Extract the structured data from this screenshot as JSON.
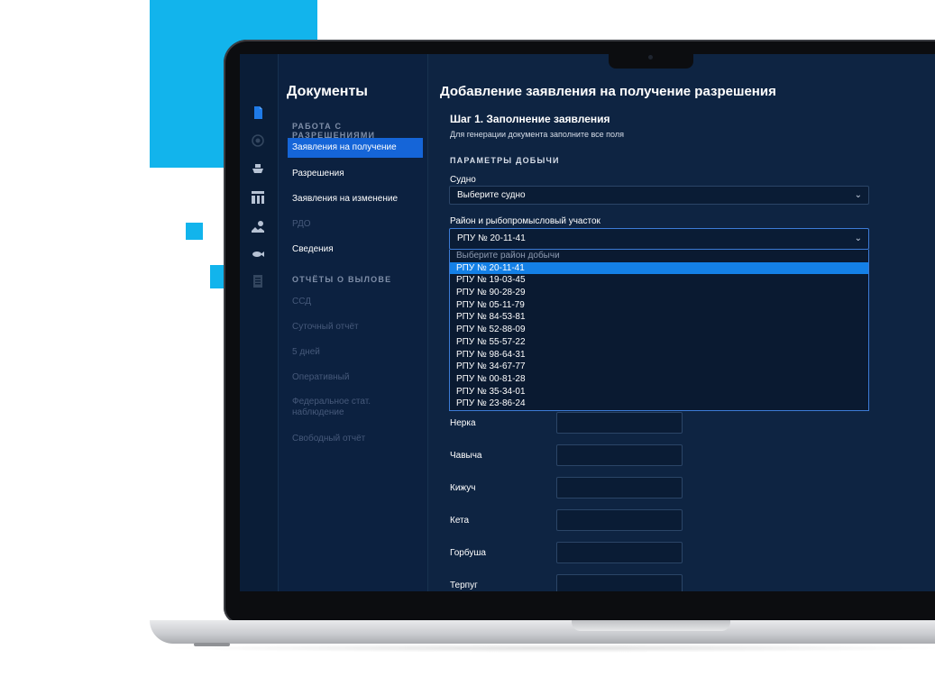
{
  "sidebar": {
    "title": "Документы",
    "section1": "РАБОТА С РАЗРЕШЕНИЯМИ",
    "items1": [
      {
        "label": "Заявления на получение"
      },
      {
        "label": "Разрешения"
      },
      {
        "label": "Заявления на изменение"
      },
      {
        "label": "РДО"
      },
      {
        "label": "Сведения"
      }
    ],
    "section2": "ОТЧЁТЫ О ВЫЛОВЕ",
    "items2": [
      {
        "label": "ССД"
      },
      {
        "label": "Суточный отчёт"
      },
      {
        "label": "5 дней"
      },
      {
        "label": "Оперативный"
      },
      {
        "label": "Федеральное стат. наблюдение"
      },
      {
        "label": "Свободный отчёт"
      }
    ]
  },
  "icons": [
    "documents-icon",
    "target-icon",
    "ship-icon",
    "dashboard-icon",
    "map-icon",
    "fish-icon",
    "report-icon"
  ],
  "main": {
    "title": "Добавление заявления на получение разрешения",
    "step_title": "Шаг 1. Заполнение заявления",
    "step_subtitle": "Для генерации документа заполните все поля",
    "params_heading": "ПАРАМЕТРЫ ДОБЫЧИ",
    "vessel": {
      "label": "Судно",
      "value": "Выберите судно"
    },
    "district": {
      "label": "Район и рыбопромысловый участок",
      "value": "РПУ № 20-11-41",
      "placeholder": "Выберите район добычи",
      "options": [
        "РПУ № 20-11-41",
        "РПУ № 19-03-45",
        "РПУ № 90-28-29",
        "РПУ № 05-11-79",
        "РПУ № 84-53-81",
        "РПУ № 52-88-09",
        "РПУ № 55-57-22",
        "РПУ № 98-64-31",
        "РПУ № 34-67-77",
        "РПУ № 00-81-28",
        "РПУ № 35-34-01",
        "РПУ № 23-86-24"
      ]
    },
    "species": [
      "Нерка",
      "Чавыча",
      "Кижуч",
      "Кета",
      "Горбуша",
      "Терпуг"
    ]
  },
  "colors": {
    "accent": "#1565d8",
    "selected": "#1480e6",
    "deco": "#12b4ec",
    "background": "#0e2442"
  }
}
